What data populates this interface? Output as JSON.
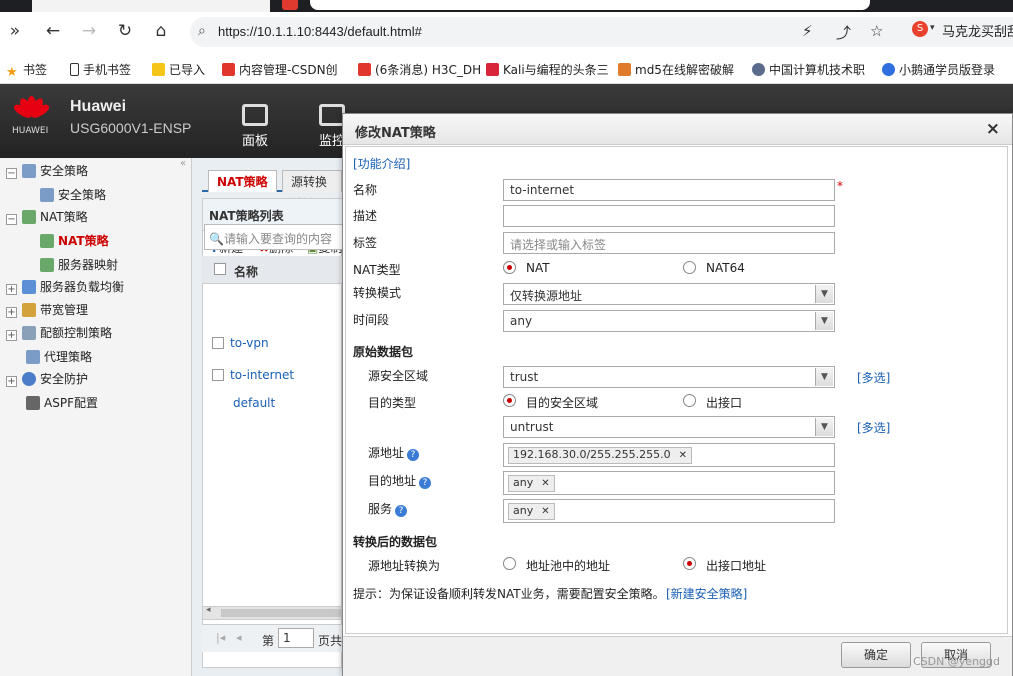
{
  "browser": {
    "url": "https://10.1.1.10:8443/default.html#",
    "search_text": "马克龙买刮刮",
    "bookmarks": [
      "书签",
      "手机书签",
      "已导入",
      "内容管理-CSDN创",
      "(6条消息) H3C_DH",
      "Kali与编程的头条三",
      "md5在线解密破解",
      "中国计算机技术职",
      "小鹅通学员版登录"
    ]
  },
  "header": {
    "logo_text": "HUAWEI",
    "brand": "Huawei",
    "model": "USG6000V1-ENSP",
    "nav": [
      "面板",
      "监控"
    ]
  },
  "tree": {
    "items": [
      "安全策略",
      "安全策略",
      "NAT策略",
      "NAT策略",
      "服务器映射",
      "服务器负载均衡",
      "带宽管理",
      "配额控制策略",
      "代理策略",
      "安全防护",
      "ASPF配置"
    ]
  },
  "list_panel": {
    "tabs": [
      "NAT策略",
      "源转换地址"
    ],
    "title": "NAT策略列表",
    "actions": [
      "新建",
      "删除",
      "复制"
    ],
    "search_placeholder": "请输入要查询的内容",
    "column": "名称",
    "rows": [
      "to-vpn",
      "to-internet",
      "default"
    ],
    "pager_page_label": "第",
    "pager_page": "1",
    "pager_suffix": "页共"
  },
  "dialog": {
    "title": "修改NAT策略",
    "intro_link": "[功能介绍]",
    "labels": {
      "name": "名称",
      "desc": "描述",
      "tag": "标签",
      "nat_type": "NAT类型",
      "mode": "转换模式",
      "time": "时间段",
      "orig_section": "原始数据包",
      "src_zone": "源安全区域",
      "dst_type": "目的类型",
      "src_addr": "源地址",
      "dst_addr": "目的地址",
      "service": "服务",
      "trans_section": "转换后的数据包",
      "src_trans": "源地址转换为"
    },
    "values": {
      "name": "to-internet",
      "desc": "",
      "tag_placeholder": "请选择或输入标签",
      "nat_type_options": [
        "NAT",
        "NAT64"
      ],
      "nat_type_selected": "NAT",
      "mode": "仅转换源地址",
      "time": "any",
      "src_zone": "trust",
      "dst_type_options": [
        "目的安全区域",
        "出接口"
      ],
      "dst_type_selected": "目的安全区域",
      "dst_zone": "untrust",
      "multi_link": "[多选]",
      "src_addr": "192.168.30.0/255.255.255.0",
      "dst_addr": "any",
      "service": "any",
      "src_trans_options": [
        "地址池中的地址",
        "出接口地址"
      ],
      "src_trans_selected": "出接口地址"
    },
    "hint": "提示：为保证设备顺利转发NAT业务，需要配置安全策略。",
    "hint_link": "[新建安全策略]",
    "required_mark": "*",
    "ok": "确定",
    "cancel": "取消"
  },
  "watermark": "CSDN @yenggd",
  "colors": {
    "accent_red": "#c00000",
    "link_blue": "#1a5fb4",
    "header_bg": "#2b2b2b",
    "brand_red": "#e60012"
  }
}
